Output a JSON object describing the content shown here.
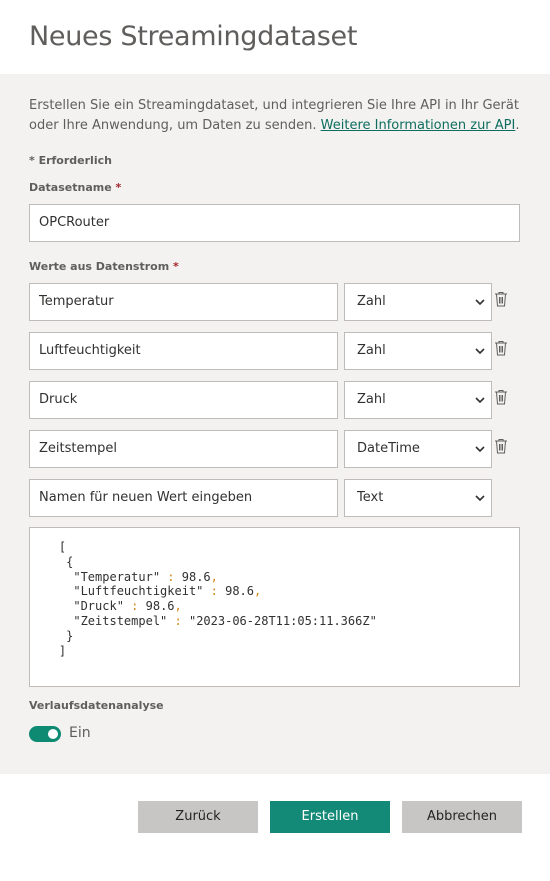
{
  "dialog": {
    "title": "Neues Streamingdataset",
    "description_text": "Erstellen Sie ein Streamingdataset, und integrieren Sie Ihre API in Ihr Gerät oder Ihre Anwendung, um Daten zu senden. ",
    "description_link": "Weitere Informationen zur API",
    "description_end": ".",
    "required_note": "* Erforderlich"
  },
  "dataset_name": {
    "label": "Datasetname",
    "required_star": "*",
    "value": "OPCRouter"
  },
  "values": {
    "label": "Werte aus Datenstrom",
    "required_star": "*",
    "rows": [
      {
        "name": "Temperatur",
        "type": "Zahl"
      },
      {
        "name": "Luftfeuchtigkeit",
        "type": "Zahl"
      },
      {
        "name": "Druck",
        "type": "Zahl"
      },
      {
        "name": "Zeitstempel",
        "type": "DateTime"
      }
    ],
    "new_value_placeholder": "Namen für neuen Wert eingeben",
    "new_value_type": "Text",
    "delete_icon": "trash-icon",
    "dropdown_icon": "chevron-down-icon"
  },
  "json_preview": {
    "open_bracket": "[",
    "open_brace": "{",
    "lines": [
      {
        "key": "\"Temperatur\"",
        "sep": " : ",
        "value": "98.6",
        "comma": ","
      },
      {
        "key": "\"Luftfeuchtigkeit\"",
        "sep": " : ",
        "value": "98.6",
        "comma": ","
      },
      {
        "key": "\"Druck\"",
        "sep": " : ",
        "value": "98.6",
        "comma": ","
      },
      {
        "key": "\"Zeitstempel\"",
        "sep": " : ",
        "value": "\"2023-06-28T11:05:11.366Z\"",
        "comma": ""
      }
    ],
    "close_brace": "}",
    "close_bracket": "]"
  },
  "history": {
    "label": "Verlaufsdatenanalyse",
    "toggle_state": "Ein",
    "toggle_on": true
  },
  "buttons": {
    "back": "Zurück",
    "create": "Erstellen",
    "cancel": "Abbrechen"
  },
  "colors": {
    "accent": "#138a77",
    "link": "#0e6d5e",
    "required": "#a4262c",
    "json_punct": "#d18616"
  }
}
